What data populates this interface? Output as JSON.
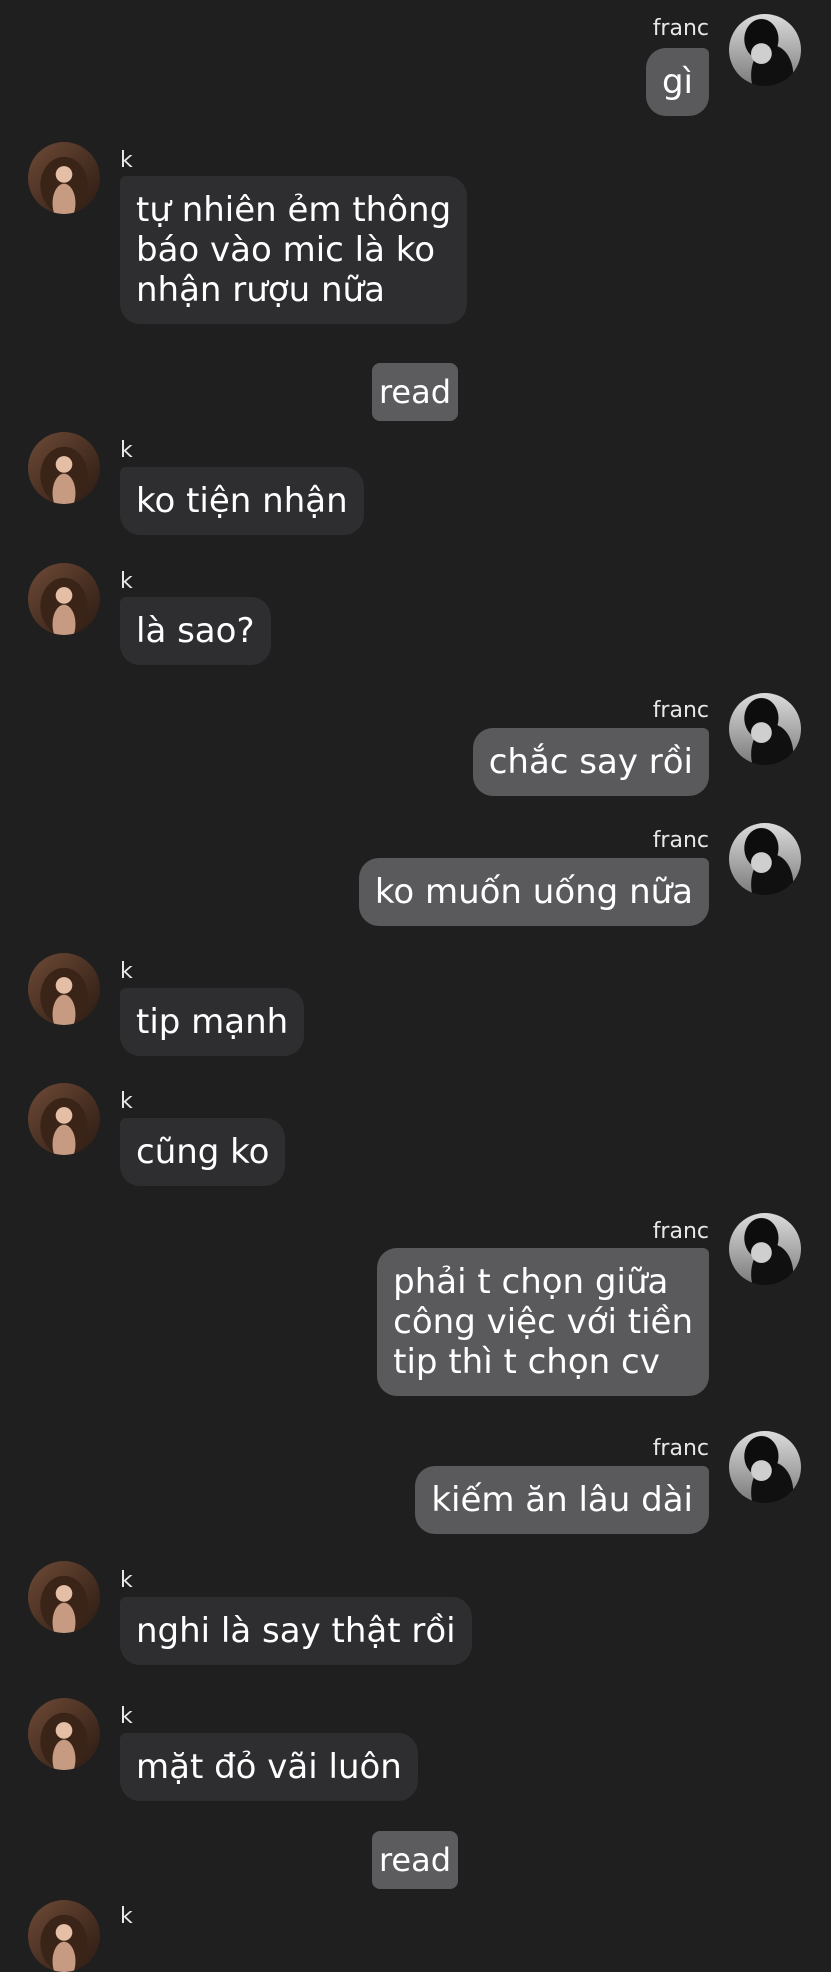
{
  "messages": [
    {
      "sender": "franc",
      "text": "gì"
    },
    {
      "sender": "k",
      "text": "tự nhiên ẻm thông\nbáo vào mic là ko\nnhận rượu nữa"
    },
    {
      "read": "read"
    },
    {
      "sender": "k",
      "text": "ko tiện nhận"
    },
    {
      "sender": "k",
      "text": "là sao?"
    },
    {
      "sender": "franc",
      "text": "chắc say rồi"
    },
    {
      "sender": "franc",
      "text": "ko muốn uống nữa"
    },
    {
      "sender": "k",
      "text": "tip mạnh"
    },
    {
      "sender": "k",
      "text": "cũng ko"
    },
    {
      "sender": "franc",
      "text": "phải t chọn giữa\ncông việc với tiền\ntip thì t chọn cv"
    },
    {
      "sender": "franc",
      "text": "kiếm ăn lâu dài"
    },
    {
      "sender": "k",
      "text": "nghi là say thật rồi"
    },
    {
      "sender": "k",
      "text": "mặt đỏ vãi luôn"
    },
    {
      "read": "read"
    },
    {
      "sender": "k",
      "text": ""
    }
  ]
}
